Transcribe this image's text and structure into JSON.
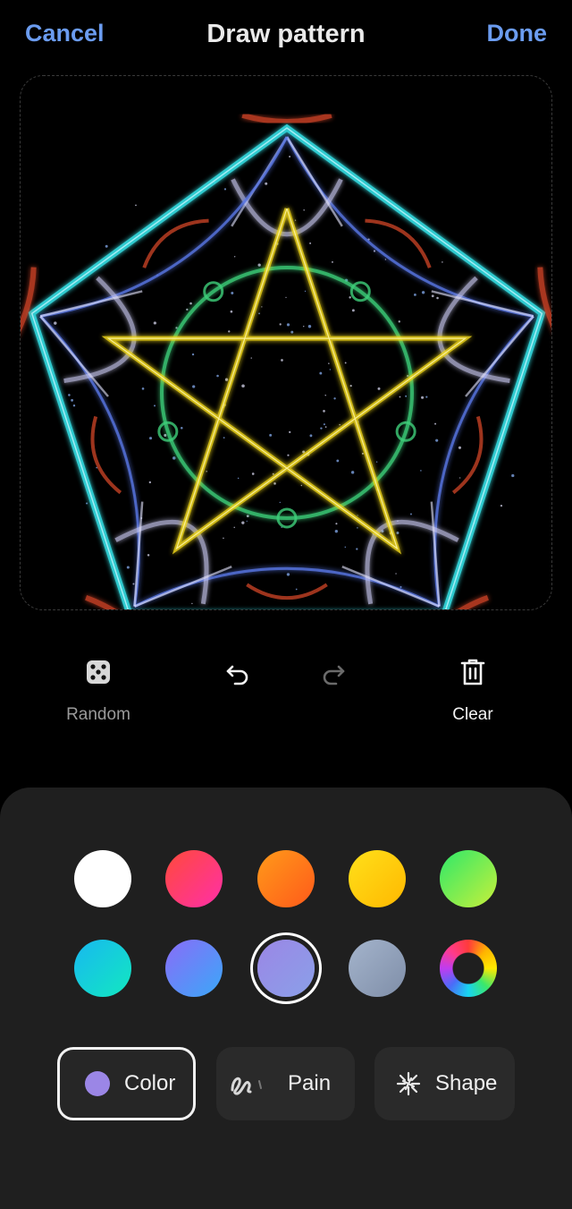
{
  "header": {
    "cancel_label": "Cancel",
    "title": "Draw pattern",
    "done_label": "Done"
  },
  "toolbar": {
    "random_label": "Random",
    "clear_label": "Clear",
    "undo_icon": "undo-icon",
    "redo_icon": "redo-icon",
    "random_icon": "dice-icon",
    "clear_icon": "trash-icon"
  },
  "canvas": {
    "pattern": "kaleidoscope pentagram pattern",
    "colors": {
      "outer_ring": "#35e0e6",
      "blue_strands": "#5a78e8",
      "lavender_strands": "#c8c8f0",
      "red_accents": "#e04a2a",
      "green_ring": "#3ecf7a",
      "yellow_star": "#f2d91a"
    }
  },
  "palette": {
    "swatches": [
      {
        "name": "white",
        "from": "#ffffff",
        "to": "#ffffff"
      },
      {
        "name": "red-pink",
        "from": "#ff4a3a",
        "to": "#ff2fa8"
      },
      {
        "name": "orange",
        "from": "#ff9a1a",
        "to": "#ff5a1a"
      },
      {
        "name": "yellow",
        "from": "#ffe01a",
        "to": "#ffb800"
      },
      {
        "name": "green",
        "from": "#2ee86a",
        "to": "#c8f03a"
      },
      {
        "name": "cyan",
        "from": "#18b8f0",
        "to": "#12e8c0"
      },
      {
        "name": "blue",
        "from": "#8a6cf8",
        "to": "#3aa8f8"
      },
      {
        "name": "lavender",
        "from": "#9b86e6",
        "to": "#8aa0e8"
      },
      {
        "name": "gray",
        "from": "#a4b4cc",
        "to": "#7f8ea8"
      },
      {
        "name": "rainbow",
        "from": "conic",
        "to": "conic"
      }
    ],
    "selected_index": 7
  },
  "modes": {
    "color_label": "Color",
    "paint_label": "Pain",
    "shape_label": "Shape",
    "active": "color",
    "color_dot": "#9b86e6"
  }
}
